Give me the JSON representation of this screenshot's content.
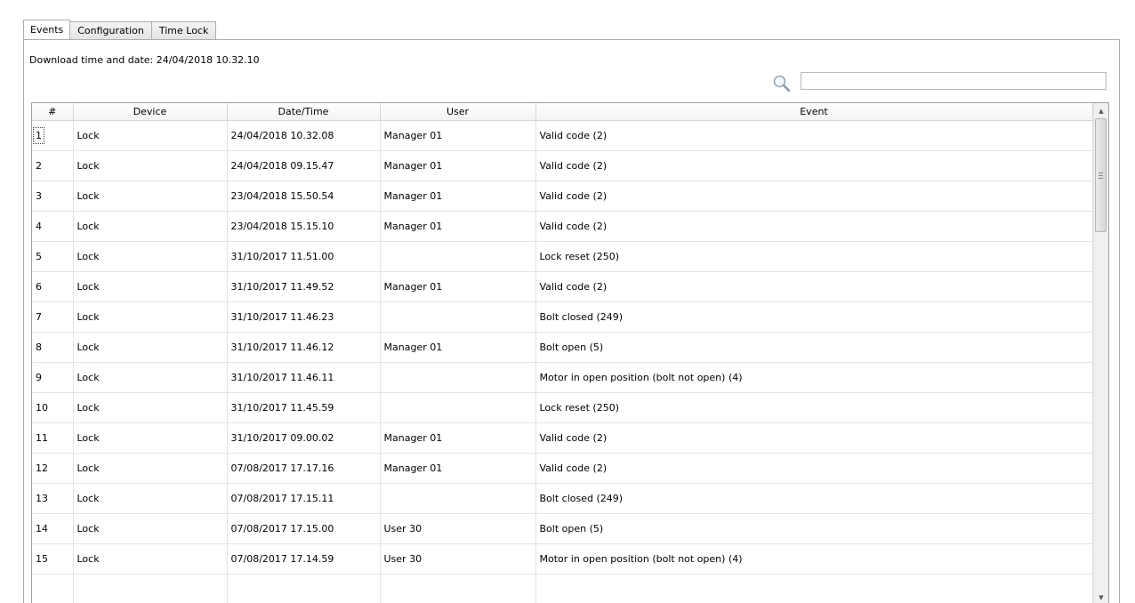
{
  "tabs": [
    {
      "label": "Events",
      "active": true
    },
    {
      "label": "Configuration",
      "active": false
    },
    {
      "label": "Time Lock",
      "active": false
    }
  ],
  "download": {
    "label": "Download time and date: 24/04/2018 10.32.10"
  },
  "search": {
    "icon": "magnifier-icon",
    "value": "",
    "placeholder": ""
  },
  "table": {
    "headers": [
      "#",
      "Device",
      "Date/Time",
      "User",
      "Event"
    ],
    "rows": [
      [
        "1",
        "Lock",
        "24/04/2018 10.32.08",
        "Manager 01",
        "Valid code (2)"
      ],
      [
        "2",
        "Lock",
        "24/04/2018 09.15.47",
        "Manager 01",
        "Valid code (2)"
      ],
      [
        "3",
        "Lock",
        "23/04/2018 15.50.54",
        "Manager 01",
        "Valid code (2)"
      ],
      [
        "4",
        "Lock",
        "23/04/2018 15.15.10",
        "Manager 01",
        "Valid code (2)"
      ],
      [
        "5",
        "Lock",
        "31/10/2017 11.51.00",
        "",
        "Lock reset (250)"
      ],
      [
        "6",
        "Lock",
        "31/10/2017 11.49.52",
        "Manager 01",
        "Valid code (2)"
      ],
      [
        "7",
        "Lock",
        "31/10/2017 11.46.23",
        "",
        "Bolt closed (249)"
      ],
      [
        "8",
        "Lock",
        "31/10/2017 11.46.12",
        "Manager 01",
        "Bolt open (5)"
      ],
      [
        "9",
        "Lock",
        "31/10/2017 11.46.11",
        "",
        "Motor in open position (bolt not open) (4)"
      ],
      [
        "10",
        "Lock",
        "31/10/2017 11.45.59",
        "",
        "Lock reset (250)"
      ],
      [
        "11",
        "Lock",
        "31/10/2017 09.00.02",
        "Manager 01",
        "Valid code (2)"
      ],
      [
        "12",
        "Lock",
        "07/08/2017 17.17.16",
        "Manager 01",
        "Valid code (2)"
      ],
      [
        "13",
        "Lock",
        "07/08/2017 17.15.11",
        "",
        "Bolt closed (249)"
      ],
      [
        "14",
        "Lock",
        "07/08/2017 17.15.00",
        "User 30",
        "Bolt open (5)"
      ],
      [
        "15",
        "Lock",
        "07/08/2017 17.14.59",
        "User 30",
        "Motor in open position (bolt not open) (4)"
      ],
      [
        "",
        "",
        "",
        "",
        ""
      ]
    ]
  },
  "colors": {
    "border": "#aeaeae",
    "grid_line": "#e3e3e3"
  }
}
